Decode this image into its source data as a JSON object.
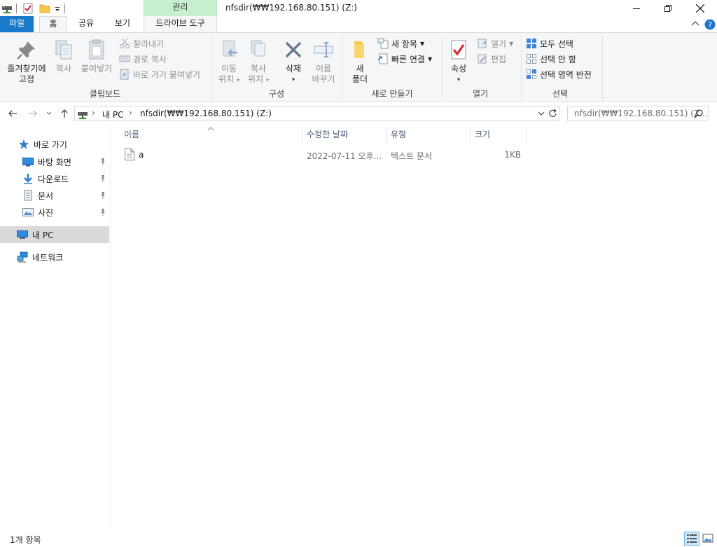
{
  "titlebar": {
    "context_tab": "관리",
    "title": "nfsdir(₩₩192.168.80.151) (Z:)"
  },
  "ribbon_tabs": {
    "file": "파일",
    "home": "홈",
    "share": "공유",
    "view": "보기",
    "drive_tools": "드라이브 도구"
  },
  "ribbon": {
    "clipboard": {
      "label": "클립보드",
      "pin_quick_access": "즐겨찾기에\n고정",
      "copy": "복사",
      "paste": "붙여넣기",
      "cut": "잘라내기",
      "copy_path": "경로 복사",
      "paste_shortcut": "바로 가기 붙여넣기"
    },
    "organize": {
      "label": "구성",
      "move_to": "이동\n위치",
      "copy_to": "복사\n위치",
      "delete": "삭제",
      "rename": "이름\n바꾸기"
    },
    "new": {
      "label": "새로 만들기",
      "new_folder": "새\n폴더",
      "new_item": "새 항목",
      "easy_access": "빠른 연결"
    },
    "open": {
      "label": "열기",
      "properties": "속성",
      "open": "열기",
      "edit": "편집"
    },
    "select": {
      "label": "선택",
      "select_all": "모두 선택",
      "select_none": "선택 안 함",
      "invert_selection": "선택 영역 반전"
    }
  },
  "address": {
    "crumb_pc": "내 PC",
    "crumb_drive": "nfsdir(₩₩192.168.80.151) (Z:)",
    "search_placeholder": "nfsdir(₩₩192.168.80.151) (Z..."
  },
  "navpane": {
    "quick_access": "바로 가기",
    "desktop": "바탕 화면",
    "downloads": "다운로드",
    "documents": "문서",
    "pictures": "사진",
    "this_pc": "내 PC",
    "network": "네트워크"
  },
  "columns": {
    "name": "이름",
    "date_modified": "수정한 날짜",
    "type": "유형",
    "size": "크기"
  },
  "files": [
    {
      "name": "a",
      "date_modified": "2022-07-11 오후...",
      "type": "텍스트 문서",
      "size": "1KB"
    }
  ],
  "status": {
    "item_count": "1개 항목"
  },
  "colors": {
    "file_tab": "#1979ca",
    "context_tab": "#c6efce",
    "selected_nav": "#d9d9d9"
  }
}
